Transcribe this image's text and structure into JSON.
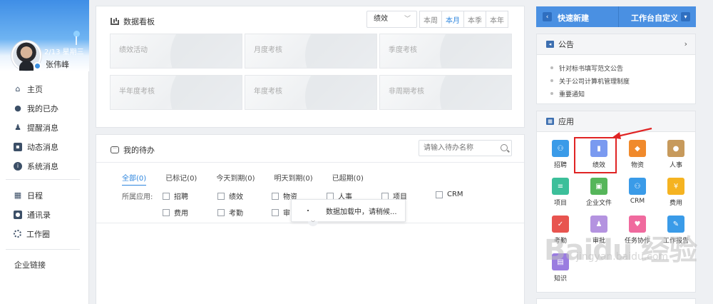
{
  "user": {
    "name": "张伟峰",
    "date": "2/13 星期三"
  },
  "nav": {
    "items": [
      {
        "icon": "home-icon",
        "glyph": "⌂",
        "label": "主页"
      },
      {
        "icon": "person-check-icon",
        "glyph": "●",
        "label": "我的已办"
      },
      {
        "icon": "bell-icon",
        "glyph": "♟",
        "label": "提醒消息"
      },
      {
        "icon": "chat-icon",
        "glyph": "▪",
        "label": "动态消息"
      },
      {
        "icon": "info-icon",
        "glyph": "i",
        "label": "系统消息"
      }
    ],
    "items2": [
      {
        "icon": "calendar-icon",
        "glyph": "▦",
        "label": "日程"
      },
      {
        "icon": "contacts-icon",
        "glyph": "●",
        "label": "通讯录"
      },
      {
        "icon": "work-circle-icon",
        "glyph": "",
        "label": "工作圈"
      }
    ],
    "links_label": "企业链接"
  },
  "dashboard": {
    "title": "数据看板",
    "select_value": "绩效",
    "periods": [
      "本周",
      "本月",
      "本季",
      "本年"
    ],
    "active_period": "本月",
    "cards": [
      "绩效活动",
      "月度考核",
      "季度考核",
      "半年度考核",
      "年度考核",
      "非周期考核"
    ]
  },
  "todo": {
    "title": "我的待办",
    "search_placeholder": "请输入待办名称",
    "tabs": [
      "全部(0)",
      "已标记(0)",
      "今天到期(0)",
      "明天到期(0)",
      "已超期(0)"
    ],
    "active_tab": "全部(0)",
    "app_label": "所属应用:",
    "filters": [
      "招聘",
      "绩效",
      "物资",
      "人事",
      "项目",
      "CRM",
      "费用",
      "考勤",
      "审"
    ],
    "loading_text": "数据加载中，请稍候..."
  },
  "quick": {
    "new_label": "快速新建",
    "custom_label": "工作台自定义"
  },
  "notice": {
    "title": "公告",
    "items": [
      "针对标书填写范文公告",
      "关于公司计算机管理制度",
      "重要通知"
    ]
  },
  "apps": {
    "title": "应用",
    "items": [
      {
        "label": "招聘",
        "icon": "recruit-icon",
        "color": "#3a9be8",
        "glyph": "⚇"
      },
      {
        "label": "绩效",
        "icon": "bar-chart-icon",
        "color": "#7a9af0",
        "glyph": "▮"
      },
      {
        "label": "物资",
        "icon": "box-icon",
        "color": "#f08a2c",
        "glyph": "◆"
      },
      {
        "label": "人事",
        "icon": "person-icon",
        "color": "#c79a5c",
        "glyph": "●"
      },
      {
        "label": "项目",
        "icon": "list-icon",
        "color": "#3cbf9a",
        "glyph": "≡"
      },
      {
        "label": "企业文件",
        "icon": "folder-icon",
        "color": "#56b65a",
        "glyph": "▣"
      },
      {
        "label": "CRM",
        "icon": "crm-icon",
        "color": "#3a9be8",
        "glyph": "⚇"
      },
      {
        "label": "费用",
        "icon": "coin-icon",
        "color": "#f5b321",
        "glyph": "¥"
      },
      {
        "label": "考勤",
        "icon": "calendar-check-icon",
        "color": "#e8544f",
        "glyph": "✓"
      },
      {
        "label": "审批",
        "icon": "approve-icon",
        "color": "#b493e0",
        "glyph": "♟"
      },
      {
        "label": "任务协作",
        "icon": "ticket-icon",
        "color": "#f06a9e",
        "glyph": "♥"
      },
      {
        "label": "工作报告",
        "icon": "report-icon",
        "color": "#3a9be8",
        "glyph": "✎"
      },
      {
        "label": "知识",
        "icon": "book-icon",
        "color": "#9a7ce0",
        "glyph": "▤"
      }
    ]
  },
  "watermark": {
    "text": "Baidu 经验",
    "url": "jingyan.baidu.com"
  }
}
